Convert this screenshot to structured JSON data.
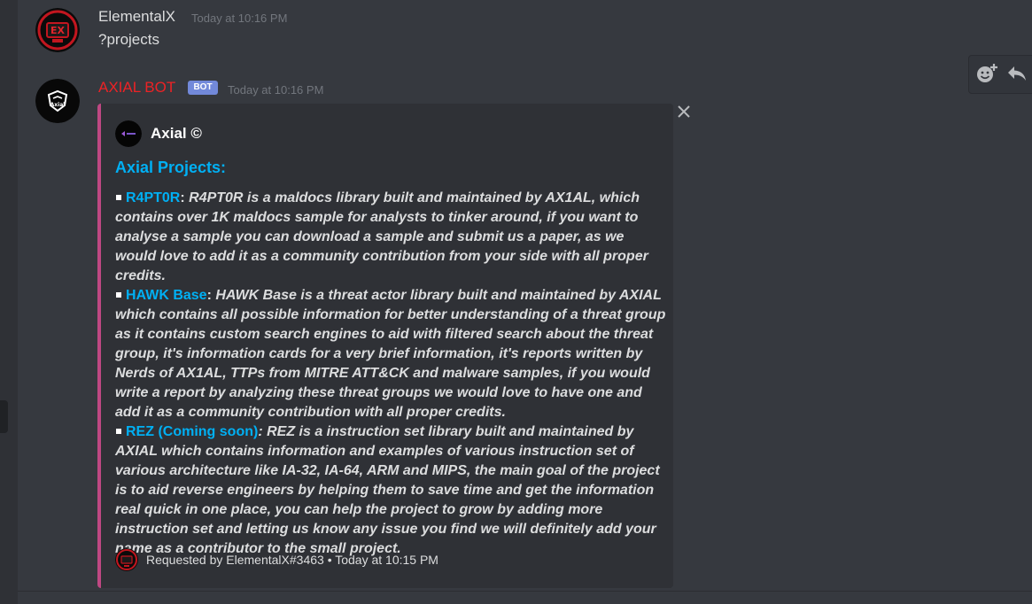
{
  "messages": [
    {
      "author": "ElementalX",
      "author_color": "#dcddde",
      "timestamp": "Today at 10:16 PM",
      "content": "?projects",
      "avatar_icon": "elementalx-avatar-icon"
    },
    {
      "author": "AXIAL BOT",
      "author_color": "#ed2225",
      "bot_tag": "BOT",
      "timestamp": "Today at 10:16 PM",
      "avatar_icon": "axial-avatar-icon",
      "embed": {
        "accent_color": "#bf4883",
        "author_name": "Axial ©",
        "title": "Axial Projects:",
        "items": [
          {
            "name": "R4PT0R",
            "separator": ":",
            "text": " R4PT0R is a maldocs library built and maintained by AX1AL, which contains over 1K maldocs sample for analysts to tinker around, if you want to analyse a sample you can download a sample and submit us a paper, as we would love to add it as a community contribution from your side with all proper credits."
          },
          {
            "name": "HAWK Base",
            "separator": ":",
            "text": " HAWK Base is a threat actor library built and maintained by AXIAL which contains all possible information for better understanding of a threat group as it contains custom search engines to aid with filtered search about the threat group, it's information cards for a very brief information, it's reports written by Nerds of AX1AL, TTPs from MITRE ATT&CK and malware samples, if you would write a report by analyzing these threat groups we would love to have one and add it as a community contribution with all proper credits."
          },
          {
            "name": "REZ (Coming soon)",
            "separator": ":",
            "text": " REZ is a instruction set library built and maintained by AXIAL which contains information and examples of various instruction set of various architecture like IA-32, IA-64, ARM and MIPS, the main goal of the project is to aid reverse engineers by helping them to save time and get the information real quick in one place, you can help the project to grow by adding more instruction set and letting us know any issue you find we will definitely add your name as a contributor to the small project."
          }
        ],
        "footer": "Requested by ElementalX#3463 • Today at 10:15 PM"
      }
    }
  ],
  "hover_actions": [
    {
      "icon": "add-reaction-icon"
    },
    {
      "icon": "reply-icon"
    }
  ],
  "colors": {
    "background": "#36393f",
    "embed_background": "#2f3136",
    "link": "#00b0f4",
    "bot_tag": "#7289da"
  }
}
